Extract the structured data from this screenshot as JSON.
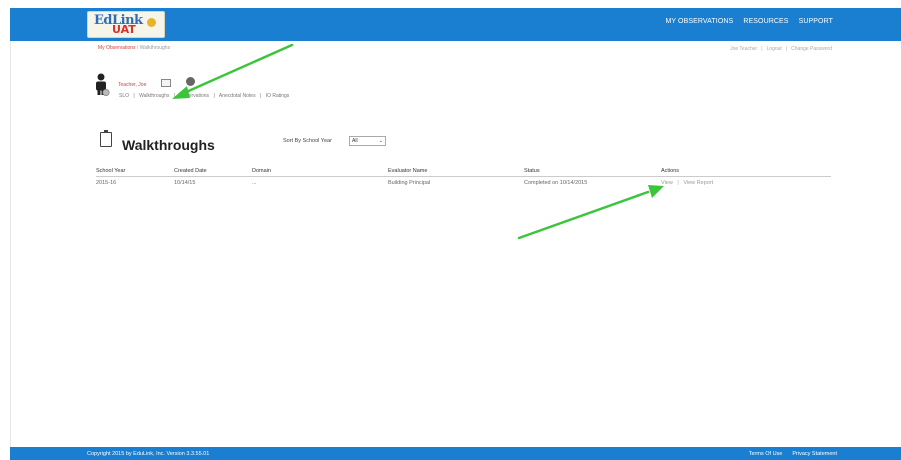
{
  "header": {
    "logo_text": "EdLink",
    "logo_badge": "UAT",
    "nav": [
      "MY OBSERVATIONS",
      "RESOURCES",
      "SUPPORT"
    ]
  },
  "breadcrumb": {
    "root": "My Observations",
    "separator": "/",
    "current": "Walkthroughs"
  },
  "user_links": [
    "Joe Teacher",
    "|",
    "Logout",
    "|",
    "Change Password"
  ],
  "profile": {
    "name": "Teacher, Joe",
    "tabs": [
      "SLO",
      "|",
      "Walkthroughs",
      "|",
      "Observations",
      "|",
      "Anecdotal Notes",
      "|",
      "IO Ratings"
    ]
  },
  "page": {
    "title": "Walkthroughs",
    "sort_label": "Sort By School Year",
    "sort_value": "All",
    "sort_chevron": "⌄"
  },
  "table": {
    "headers": [
      "School Year",
      "Created Date",
      "Domain",
      "Evaluator Name",
      "Status",
      "Actions"
    ],
    "rows": [
      {
        "school_year": "2015-16",
        "created_date": "10/14/15",
        "domain": "...",
        "evaluator": "Building Principal",
        "status": "Completed on 10/14/2015",
        "action_view": "View",
        "action_sep": "|",
        "action_report": "View Report"
      }
    ]
  },
  "footer": {
    "copyright": "Copyright 2015 by EduLink, Inc.   Version 3.3.55.01",
    "links": [
      "Terms Of Use",
      "Privacy Statement"
    ]
  },
  "colors": {
    "brand_blue": "#1a7fd0",
    "annotation_arrow": "#3cc43c",
    "link_red": "#cc4444"
  }
}
